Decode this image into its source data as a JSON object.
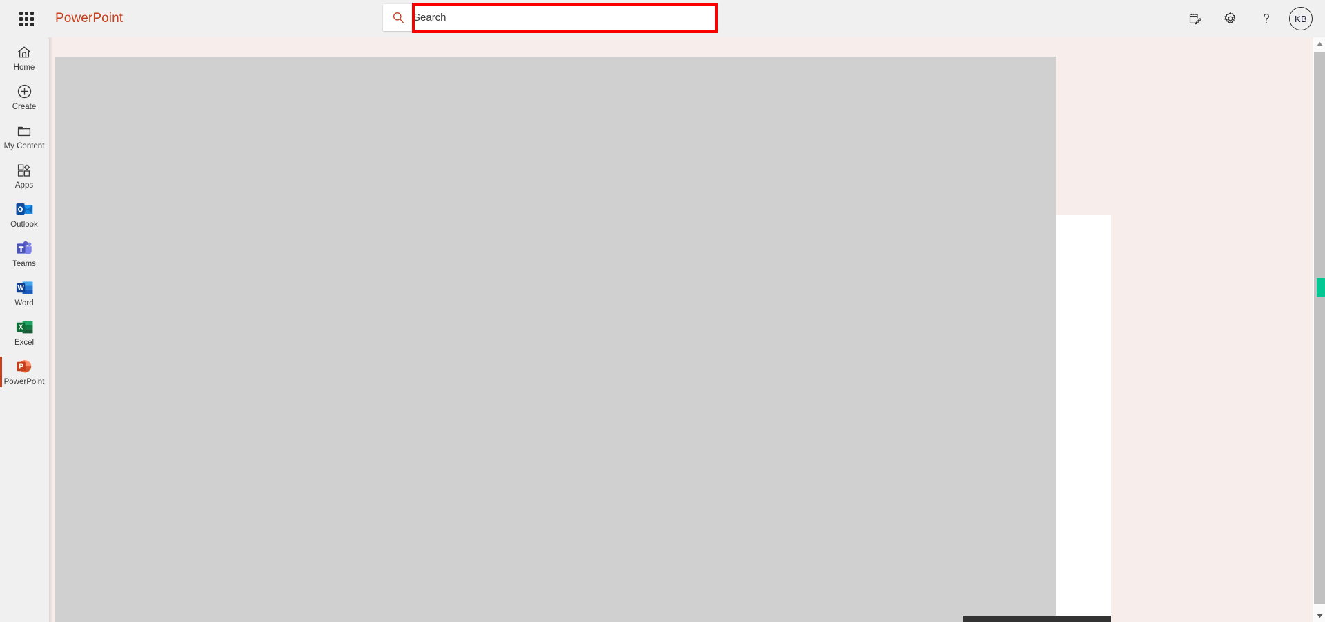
{
  "header": {
    "app_launcher_label": "app-launcher",
    "brand": "PowerPoint",
    "brand_color": "#c5411e",
    "search": {
      "placeholder": "Search",
      "value": "",
      "icon": "search-icon"
    },
    "actions": [
      {
        "name": "notes-feedback-icon",
        "label": "Notes"
      },
      {
        "name": "gear-icon",
        "label": "Settings"
      },
      {
        "name": "help-icon",
        "label": "Help",
        "glyph": "?"
      }
    ],
    "avatar": {
      "initials": "KB",
      "label": "Account manager"
    }
  },
  "annotation": {
    "type": "highlight-rectangle",
    "color": "#fc0000",
    "target": "search-input"
  },
  "sidebar": {
    "items": [
      {
        "label": "Home",
        "icon": "home-icon",
        "kind": "glyph",
        "active": false
      },
      {
        "label": "Create",
        "icon": "plus-circle-icon",
        "kind": "glyph",
        "active": false
      },
      {
        "label": "My Content",
        "icon": "folder-icon",
        "kind": "glyph",
        "active": false
      },
      {
        "label": "Apps",
        "icon": "apps-grid-icon",
        "kind": "glyph",
        "active": false
      },
      {
        "label": "Outlook",
        "icon": "outlook-icon",
        "kind": "app",
        "active": false,
        "color": "#0f6cbd"
      },
      {
        "label": "Teams",
        "icon": "teams-icon",
        "kind": "app",
        "active": false,
        "color": "#5b5fc7"
      },
      {
        "label": "Word",
        "icon": "word-icon",
        "kind": "app",
        "active": false,
        "color": "#185abd"
      },
      {
        "label": "Excel",
        "icon": "excel-icon",
        "kind": "app",
        "active": false,
        "color": "#107c41"
      },
      {
        "label": "PowerPoint",
        "icon": "powerpoint-icon",
        "kind": "app",
        "active": true,
        "color": "#c43e1c"
      }
    ]
  },
  "main": {
    "state": "loading",
    "background_color": "#f7eeec",
    "placeholder_color": "#d0d0d0"
  },
  "scrollbars": {
    "vertical": {
      "up_arrow": "▲",
      "down_arrow": "▼",
      "thumb_color": "#c1c1c1",
      "accent_color": "#03c894"
    },
    "horizontal": {
      "thumb_color": "#333333"
    }
  }
}
